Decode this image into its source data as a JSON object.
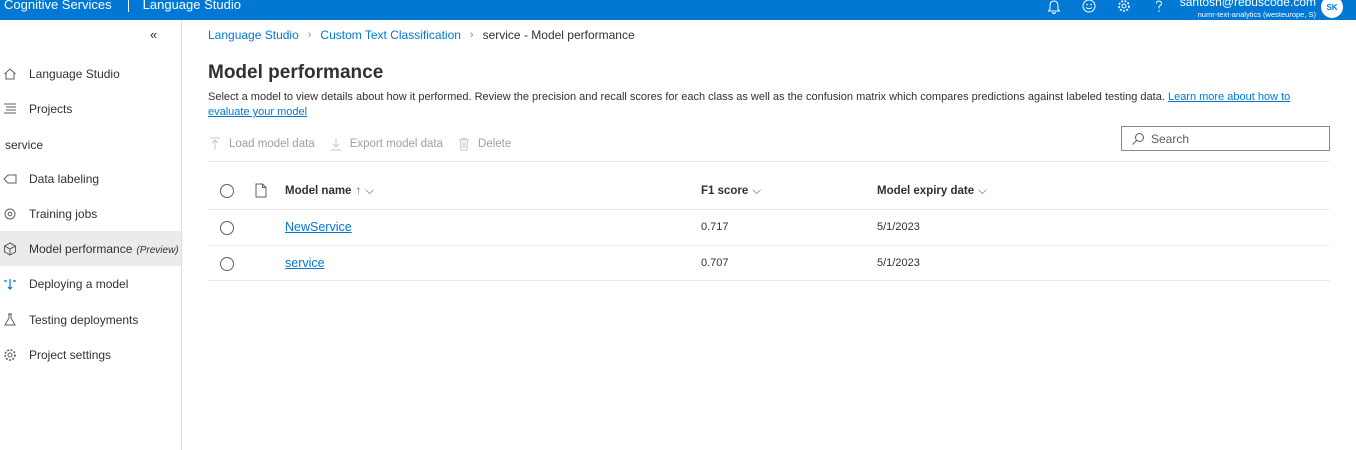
{
  "topbar": {
    "app_name": "Cognitive Services",
    "studio_name": "Language Studio",
    "user_email": "santosh@rebuscode.com",
    "user_tenant": "numr-text-analytics (westeurope, S)",
    "avatar_initials": "SK"
  },
  "sidebar": {
    "collapse_glyph": "«",
    "items_top": [
      {
        "label": "Language Studio",
        "icon": "home-icon"
      },
      {
        "label": "Projects",
        "icon": "list-icon"
      }
    ],
    "section_label": "service",
    "items_project": [
      {
        "label": "Data labeling",
        "icon": "tag-icon"
      },
      {
        "label": "Training jobs",
        "icon": "training-icon"
      },
      {
        "label": "Model performance",
        "badge": "(Preview)",
        "icon": "cube-icon",
        "active": true
      },
      {
        "label": "Deploying a model",
        "icon": "deploy-icon"
      },
      {
        "label": "Testing deployments",
        "icon": "flask-icon"
      },
      {
        "label": "Project settings",
        "icon": "gear-icon"
      }
    ]
  },
  "breadcrumb": {
    "items": [
      "Language Studio",
      "Custom Text Classification"
    ],
    "current": "service - Model performance"
  },
  "page": {
    "title": "Model performance",
    "description": "Select a model to view details about how it performed. Review the precision and recall scores for each class as well as the confusion matrix which compares predictions against labeled testing data.",
    "learn_more": "Learn more about how to evaluate your model"
  },
  "toolbar": {
    "load": "Load model data",
    "export": "Export model data",
    "delete": "Delete"
  },
  "search": {
    "placeholder": "Search"
  },
  "table": {
    "columns": {
      "model_name": "Model name",
      "model_name_sort": "↑",
      "f1": "F1 score",
      "expiry": "Model expiry date"
    },
    "rows": [
      {
        "name": "NewService",
        "f1": "0.717",
        "expiry": "5/1/2023"
      },
      {
        "name": "service",
        "f1": "0.707",
        "expiry": "5/1/2023"
      }
    ]
  },
  "colors": {
    "accent": "#0078d4",
    "active_nav": "#edebe9",
    "text": "#323130",
    "disabled": "#a19f9d"
  }
}
